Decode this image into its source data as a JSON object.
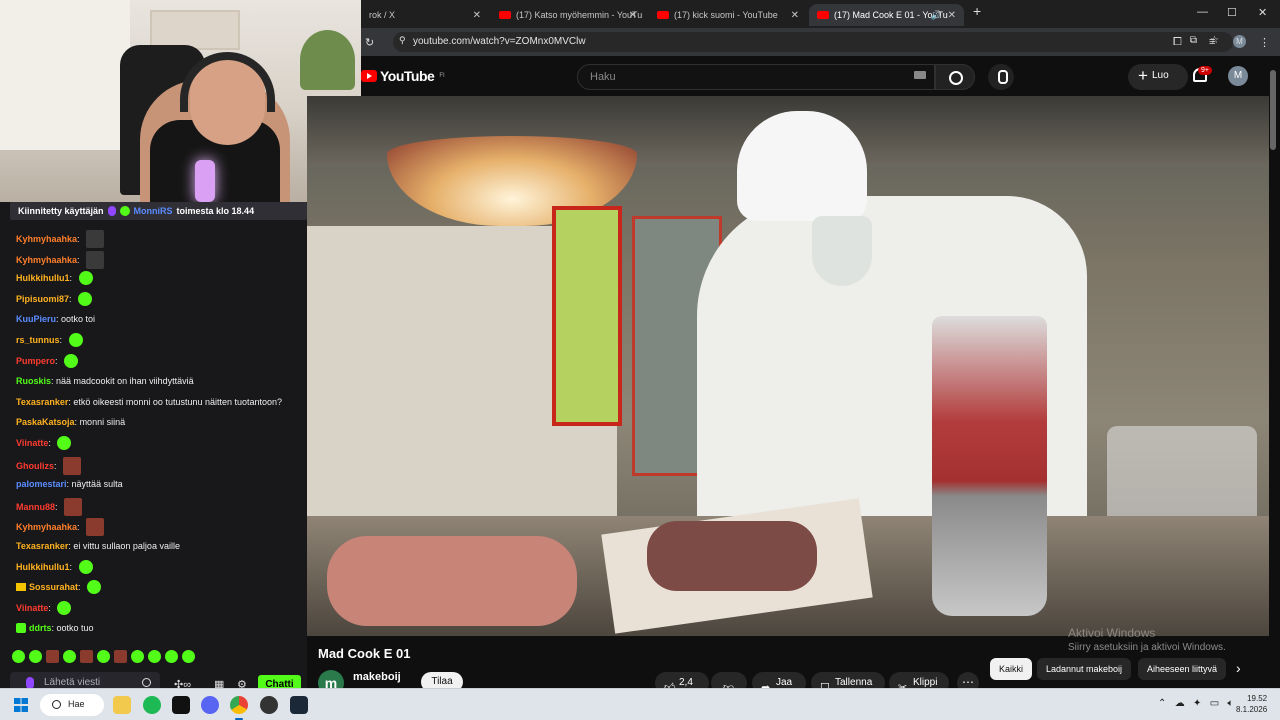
{
  "stream": {
    "pinned_prefix": "Kiinnitetty käyttäjän",
    "pinned_user": "MonniRS",
    "pinned_suffix": "toimesta klo 18.44",
    "messages": [
      {
        "user": "Kyhmyhaahka",
        "color": "#ff7f2a",
        "text": "",
        "emote": "dark"
      },
      {
        "user": "Kyhmyhaahka",
        "color": "#ff7f2a",
        "text": "",
        "emote": "dark"
      },
      {
        "user": "Hulkkihullu1",
        "color": "#ffb21e",
        "text": "",
        "emote": "green"
      },
      {
        "user": "Pipisuomi87",
        "color": "#ffb21e",
        "text": "",
        "emote": "green"
      },
      {
        "user": "KuuPieru",
        "color": "#5b8cff",
        "text": "ootko toi",
        "emote": ""
      },
      {
        "user": "rs_tunnus",
        "color": "#ffb21e",
        "text": "",
        "emote": "green"
      },
      {
        "user": "Pumpero",
        "color": "#ff3b30",
        "text": "",
        "emote": "green"
      },
      {
        "user": "Ruoskis",
        "color": "#53fc18",
        "text": "nää madcookit on ihan viihdyttäviä",
        "emote": ""
      },
      {
        "user": "Texasranker",
        "color": "#ffb21e",
        "text": "etkö oikeesti monni oo tutustunu näitten tuotantoon?",
        "emote": ""
      },
      {
        "user": "PaskaKatsoja",
        "color": "#ffb21e",
        "text": "monni siinä",
        "emote": ""
      },
      {
        "user": "Viinatte",
        "color": "#ff3b30",
        "text": "",
        "emote": "green"
      },
      {
        "user": "Ghoulizs",
        "color": "#ff3b30",
        "text": "",
        "emote": "face"
      },
      {
        "user": "palomestari",
        "color": "#5b8cff",
        "text": "näyttää sulta",
        "emote": ""
      },
      {
        "user": "Mannu88",
        "color": "#ff3b30",
        "text": "",
        "emote": "face"
      },
      {
        "user": "Kyhmyhaahka",
        "color": "#ff7f2a",
        "text": "",
        "emote": "face"
      },
      {
        "user": "Texasranker",
        "color": "#ffb21e",
        "text": "ei vittu sullaon paljoa vaille",
        "emote": ""
      },
      {
        "user": "Hulkkihullu1",
        "color": "#ffb21e",
        "text": "",
        "emote": "green"
      },
      {
        "user": "Sossurahat",
        "color": "#ffb21e",
        "text": "",
        "emote": "green",
        "badge": "crown"
      },
      {
        "user": "Viinatte",
        "color": "#ff3b30",
        "text": "",
        "emote": "green"
      },
      {
        "user": "ddrts",
        "color": "#53fc18",
        "text": "ootko tuo",
        "emote": "",
        "badge": "pot"
      }
    ],
    "chat_placeholder": "Lähetä viesti",
    "chat_button": "Chatti"
  },
  "browser": {
    "tabs": [
      {
        "title": "rok / X",
        "active": false
      },
      {
        "title": "(17) Katso myöhemmin - YouTu",
        "active": false
      },
      {
        "title": "(17) kick suomi - YouTube",
        "active": false
      },
      {
        "title": "(17) Mad Cook E 01 - YouTu",
        "active": true
      }
    ],
    "url": "youtube.com/watch?v=ZOMnx0MVClw"
  },
  "youtube": {
    "logo": "YouTube",
    "region": "FI",
    "search_placeholder": "Haku",
    "create_label": "Luo",
    "notif_count": "9+",
    "avatar_letter": "M",
    "video_title": "Mad Cook E 01",
    "channel_initial": "m",
    "channel_name": "makeboij",
    "subscribe_label": "Tilaa",
    "likes": "2,4 t.",
    "share_label": "Jaa",
    "save_label": "Tallenna",
    "clip_label": "Klippi",
    "chips": [
      "Kaikki",
      "Ladannut makeboij",
      "Aiheeseen liittyvä"
    ],
    "watermark_title": "Aktivoi Windows",
    "watermark_text": "Siirry asetuksiin ja aktivoi Windows."
  },
  "taskbar": {
    "search_label": "Hae",
    "time": "19.52",
    "date": "8.1.2026"
  }
}
